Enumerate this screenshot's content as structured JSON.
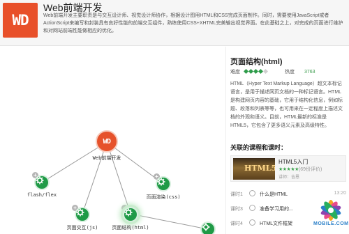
{
  "header": {
    "logo_text": "WD",
    "title": "Web前端开发",
    "description": "Web前端开发主要职责是与交互设计师、视觉设计师协作，根据设计图用HTML和CSS完成页面制作。同时，需要使用JavaScript或者ActionScript来编写和封装具有良好性能的前端交互组件，熟练使用CSS+XHTML完美输出视觉界面。在此基础之上，对完成的页面进行维护和对网站前端性能做相应的优化。"
  },
  "map": {
    "root": {
      "logo": "WD",
      "label": "Web前端开发"
    },
    "nodes": [
      {
        "label": "flash/flex",
        "toggle": "+"
      },
      {
        "label": "页面渲染(css)",
        "toggle": "+"
      },
      {
        "label": "页面交互(js)",
        "toggle": "+"
      },
      {
        "label": "页面结构(html)",
        "toggle": "−"
      }
    ]
  },
  "panel": {
    "title": "页面结构(html)",
    "difficulty_label": "难度",
    "difficulty_level": 4,
    "difficulty_max": 5,
    "heat_label": "热度",
    "heat_value": "3763",
    "description": "HTML（Hyper Text Markup Language）超文本标记语言，是用于描述网页文档的一种标记语言。HTML是构建网页内容的基础，它用于结构化信息，例如标题、段落和列表等等，也可用来在一定程度上描述文档的外观和语义。目前，HTML最新的标准是HTML5，它包含了更多语义元素及高级特性。",
    "related_title": "关联的课程和课时：",
    "course": {
      "thumb_text": "HTML5",
      "name": "HTML5入门",
      "stars": "★★★★★",
      "count": "(69份评价)",
      "teacher": "讲师：吉恩"
    },
    "lessons": [
      {
        "label": "课时1",
        "name": "什么是HTML",
        "time": "13:20"
      },
      {
        "label": "课时3",
        "name": "准备学习用的...",
        "time": ""
      },
      {
        "label": "课时4",
        "name": "HTML文件框架",
        "time": ""
      }
    ]
  },
  "watermark": {
    "text": "MOBILE.COM"
  },
  "colors": {
    "accent": "#e6522b",
    "node_green": "#1f9a46",
    "heat": "#3a9b4c"
  }
}
